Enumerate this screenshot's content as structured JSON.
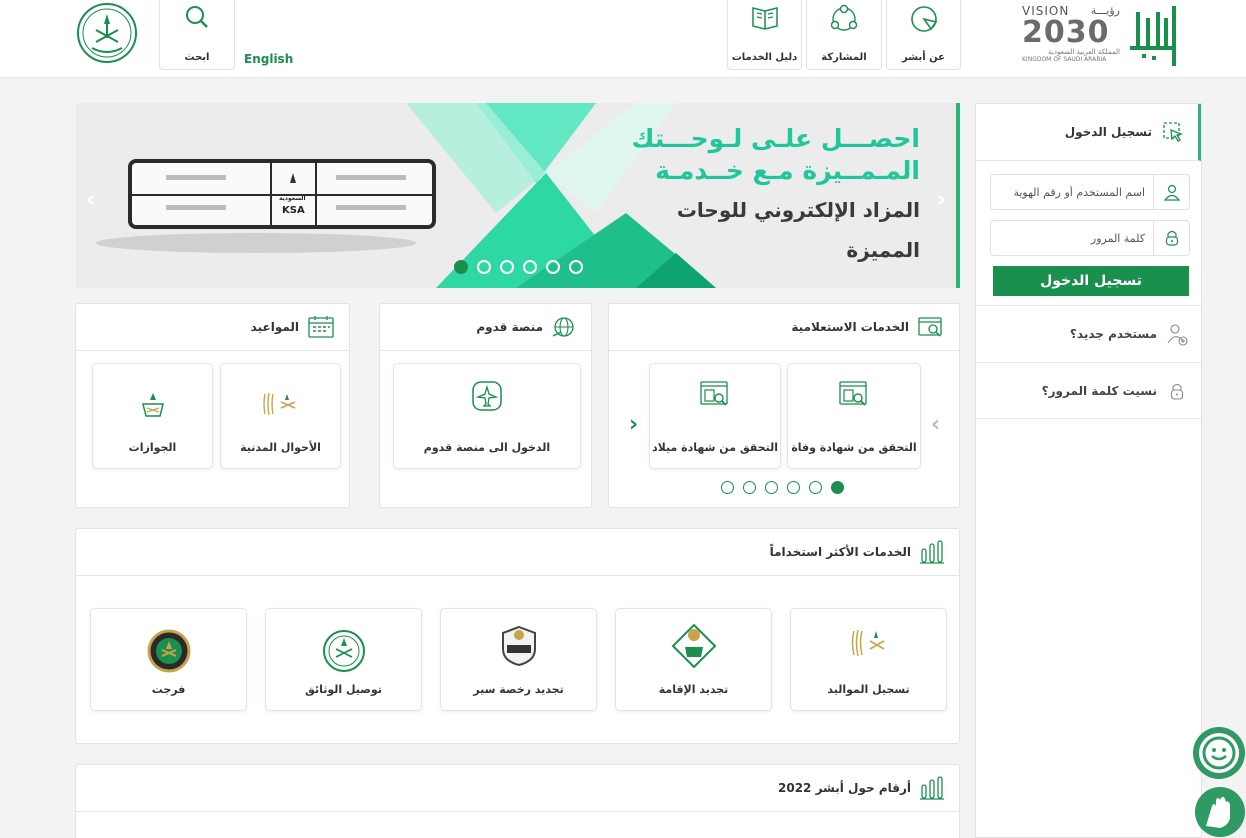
{
  "header": {
    "about_label": "عن أبشر",
    "participation_label": "المشاركة",
    "guide_label": "دليل الخدمات",
    "search_label": "ابحث",
    "english_label": "English",
    "vision_text": "VISION",
    "vision_year": "2030",
    "vision_ar": "رؤيـــة",
    "vision_kingdom_ar": "المملكة العربية السعودية",
    "vision_kingdom_en": "KINGDOM OF SAUDI ARABIA"
  },
  "banner": {
    "line1": "احصـــل علـى لـوحـــتك",
    "line2": "المـمــيزة مـع خــدمـة",
    "line3": "المزاد الإلكتروني للوحات",
    "line4": "المميزة",
    "plate_text": "KSA",
    "plate_ar": "السعودية",
    "slides": 6,
    "active_slide": 1
  },
  "inquiry": {
    "title": "الخدمات الاستعلامية",
    "items": [
      {
        "label": "التحقق من شهادة وفاة"
      },
      {
        "label": "التحقق من شهادة ميلاد"
      }
    ],
    "pages": 6,
    "active_page": 1
  },
  "qudoom": {
    "title": "منصة قدوم",
    "items": [
      {
        "label": "الدخول الى منصة قدوم"
      }
    ]
  },
  "appointments": {
    "title": "المواعيد",
    "items": [
      {
        "label": "الأحوال المدنية"
      },
      {
        "label": "الجوازات"
      }
    ]
  },
  "most_used": {
    "title": "الخدمات الأكثر استخداماً",
    "items": [
      {
        "label": "تسجيل المواليد"
      },
      {
        "label": "تجديد الإقامة"
      },
      {
        "label": "تجديد رخصة سير"
      },
      {
        "label": "توصيل الوثائق"
      },
      {
        "label": "فرجت"
      }
    ]
  },
  "stats": {
    "title": "أرقام حول أبشر 2022"
  },
  "login": {
    "title": "تسجيل الدخول",
    "username_placeholder": "اسم المستخدم أو رقم الهوية",
    "password_placeholder": "كلمة المرور",
    "submit_label": "تسجيل الدخول",
    "new_user_label": "مستخدم جديد؟",
    "forgot_label": "نسيت كلمة المرور؟"
  },
  "colors": {
    "primary": "#1a8f4e",
    "accent": "#2bb673",
    "banner_text": "#20c79a"
  }
}
